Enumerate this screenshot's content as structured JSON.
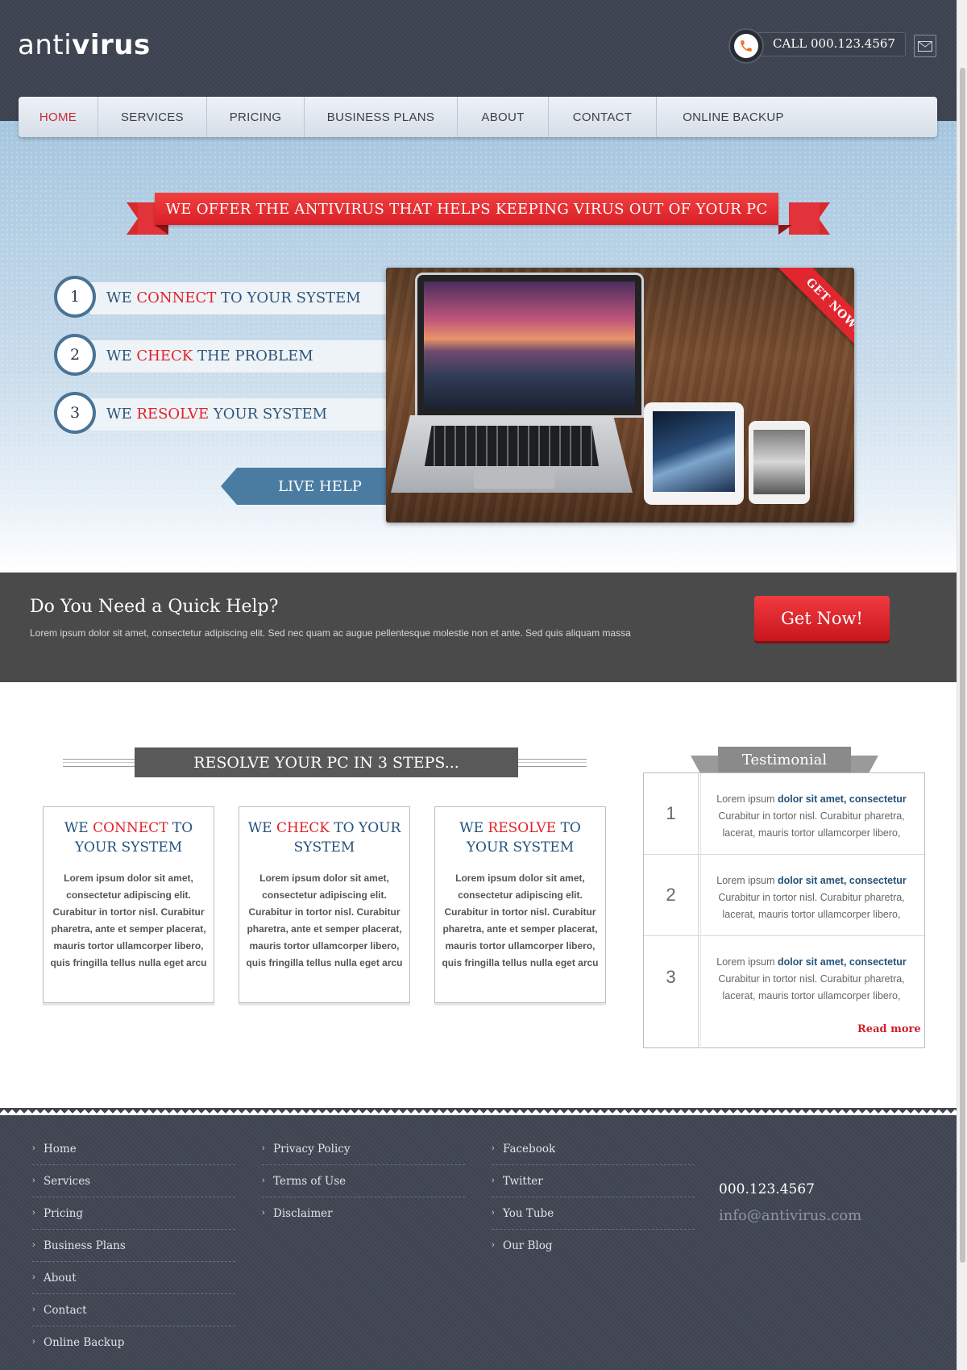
{
  "header": {
    "logo_thin": "anti",
    "logo_bold": "virus",
    "call_text": "CALL 000.123.4567",
    "icons": {
      "phone": "phone-icon",
      "mail": "mail-icon"
    }
  },
  "nav": {
    "items": [
      {
        "label": "HOME",
        "active": true
      },
      {
        "label": "SERVICES",
        "active": false
      },
      {
        "label": "PRICING",
        "active": false
      },
      {
        "label": "BUSINESS PLANS",
        "active": false
      },
      {
        "label": "ABOUT",
        "active": false
      },
      {
        "label": "CONTACT",
        "active": false
      },
      {
        "label": "ONLINE BACKUP",
        "active": false
      }
    ]
  },
  "hero": {
    "banner": "WE OFFER THE ANTIVIRUS THAT HELPS KEEPING VIRUS OUT OF YOUR PC",
    "steps": [
      {
        "num": "1",
        "pre": "WE ",
        "accent": "CONNECT",
        "post": " TO YOUR SYSTEM"
      },
      {
        "num": "2",
        "pre": "WE ",
        "accent": "CHECK",
        "post": " THE PROBLEM"
      },
      {
        "num": "3",
        "pre": "WE ",
        "accent": "RESOLVE",
        "post": " YOUR SYSTEM"
      }
    ],
    "live_help": "LIVE HELP",
    "ribbon": "GET NOW!"
  },
  "quick_help": {
    "title": "Do You Need a Quick Help?",
    "text": "Lorem ipsum dolor sit amet, consectetur adipiscing elit. Sed nec quam ac augue pellentesque molestie non et ante. Sed quis aliquam massa",
    "button": "Get Now!"
  },
  "steps_section": {
    "heading": "RESOLVE YOUR PC IN 3 STEPS...",
    "cards": [
      {
        "pre": "WE ",
        "accent": "CONNECT",
        "post": " TO YOUR SYSTEM",
        "text": "Lorem ipsum dolor sit amet, consectetur adipiscing elit. Curabitur in tortor nisl. Curabitur pharetra, ante et semper placerat, mauris tortor ullamcorper libero, quis fringilla tellus nulla eget arcu"
      },
      {
        "pre": "WE ",
        "accent": "CHECK",
        "post": " TO YOUR SYSTEM",
        "text": "Lorem ipsum dolor sit amet, consectetur adipiscing elit. Curabitur in tortor nisl. Curabitur pharetra, ante et semper placerat, mauris tortor ullamcorper libero, quis fringilla tellus nulla eget arcu"
      },
      {
        "pre": "WE ",
        "accent": "RESOLVE",
        "post": " TO YOUR SYSTEM",
        "text": "Lorem ipsum dolor sit amet, consectetur adipiscing elit. Curabitur in tortor nisl. Curabitur pharetra, ante et semper placerat, mauris tortor ullamcorper libero, quis fringilla tellus nulla eget arcu"
      }
    ]
  },
  "testimonial": {
    "title": "Testimonial",
    "items": [
      {
        "num": "1",
        "pre": "Lorem ipsum ",
        "hl": "dolor sit amet, consectetur",
        "post": " Curabitur in tortor nisl. Curabitur pharetra, lacerat, mauris tortor ullamcorper libero,"
      },
      {
        "num": "2",
        "pre": "Lorem ipsum ",
        "hl": "dolor sit amet, consectetur",
        "post": " Curabitur in tortor nisl. Curabitur pharetra, lacerat, mauris tortor ullamcorper libero,"
      },
      {
        "num": "3",
        "pre": "Lorem ipsum ",
        "hl": "dolor sit amet, consectetur",
        "post": " Curabitur in tortor nisl. Curabitur pharetra, lacerat, mauris tortor ullamcorper libero,"
      }
    ],
    "read_more": "Read more"
  },
  "footer": {
    "col1": [
      "Home",
      "Services",
      "Pricing",
      "Business Plans",
      "About",
      "Contact",
      "Online Backup"
    ],
    "col2": [
      "Privacy Policy",
      "Terms of Use",
      "Disclaimer"
    ],
    "col3": [
      "Facebook",
      "Twitter",
      "You Tube",
      "Our Blog"
    ],
    "phone": "000.123.4567",
    "email": "info@antivirus.com"
  },
  "colors": {
    "accent_red": "#e0222a",
    "navy_text": "#24527a",
    "header_bg": "#3d4451",
    "quick_help_bg": "#4a4a4a"
  }
}
